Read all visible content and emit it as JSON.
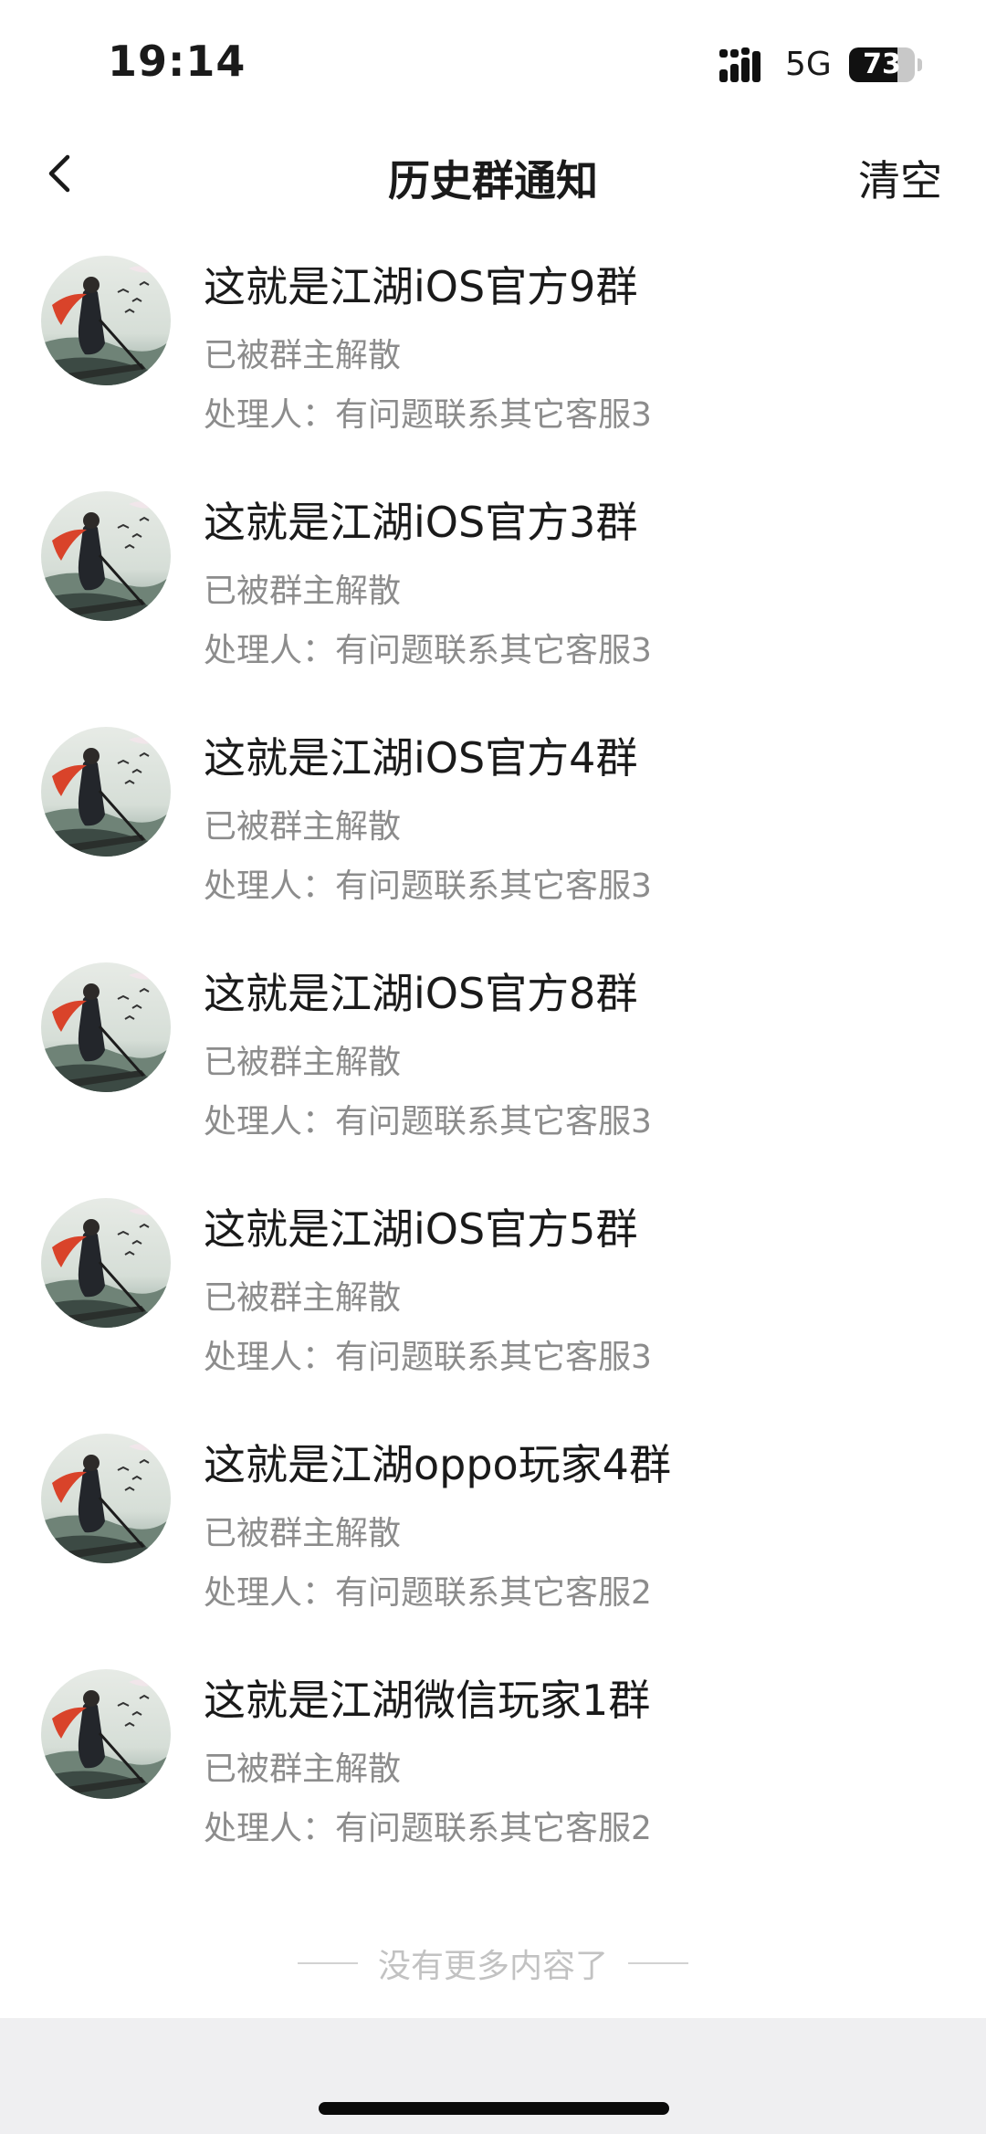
{
  "status_bar": {
    "time": "19:14",
    "network": "5G",
    "battery_percent": 73,
    "battery_label": "73"
  },
  "nav": {
    "title": "历史群通知",
    "clear_label": "清空",
    "back_icon": "chevron-left-icon"
  },
  "notices": [
    {
      "title": "这就是江湖iOS官方9群",
      "status": "已被群主解散",
      "handler": "处理人：有问题联系其它客服3"
    },
    {
      "title": "这就是江湖iOS官方3群",
      "status": "已被群主解散",
      "handler": "处理人：有问题联系其它客服3"
    },
    {
      "title": "这就是江湖iOS官方4群",
      "status": "已被群主解散",
      "handler": "处理人：有问题联系其它客服3"
    },
    {
      "title": "这就是江湖iOS官方8群",
      "status": "已被群主解散",
      "handler": "处理人：有问题联系其它客服3"
    },
    {
      "title": "这就是江湖iOS官方5群",
      "status": "已被群主解散",
      "handler": "处理人：有问题联系其它客服3"
    },
    {
      "title": "这就是江湖oppo玩家4群",
      "status": "已被群主解散",
      "handler": "处理人：有问题联系其它客服2"
    },
    {
      "title": "这就是江湖微信玩家1群",
      "status": "已被群主解散",
      "handler": "处理人：有问题联系其它客服2"
    }
  ],
  "end_text": "没有更多内容了",
  "colors": {
    "text_primary": "#1a1a1a",
    "text_secondary": "#8c8c8c",
    "text_end": "#c2c2c2",
    "bottom_area": "#efeff1"
  }
}
